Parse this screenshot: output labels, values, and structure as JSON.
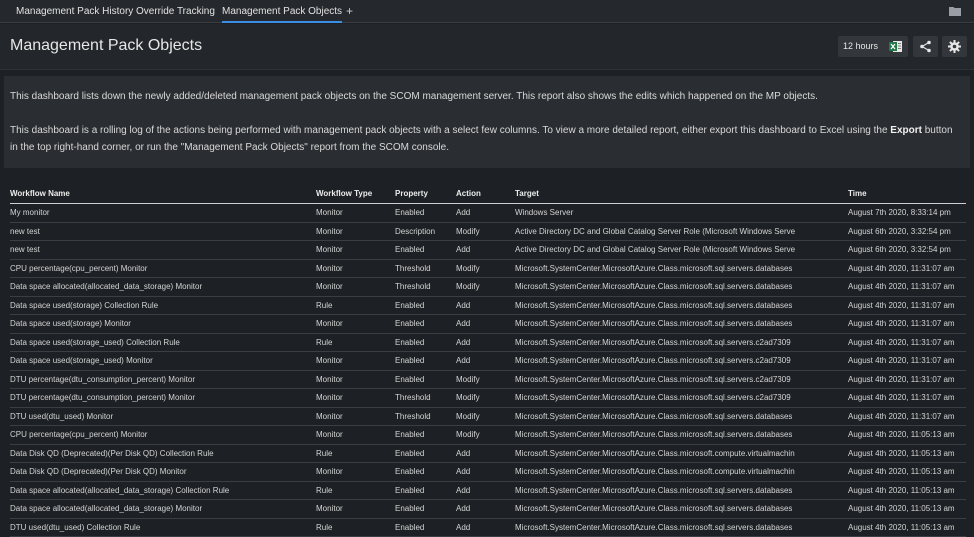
{
  "tabs": [
    {
      "label": "Management Pack History",
      "active": false
    },
    {
      "label": "Override Tracking",
      "active": false
    },
    {
      "label": "Management Pack Objects",
      "active": true
    }
  ],
  "add_tab_label": "+",
  "header": {
    "title": "Management Pack Objects",
    "time_range": "12 hours"
  },
  "description": {
    "p1": "This dashboard lists down the newly added/deleted management pack objects on the SCOM management server. This report also shows the edits which happened on the MP objects.",
    "p2_before": "This dashboard is a rolling log of the actions being performed with management pack objects with a select few columns. To view a more detailed report, either export this dashboard to Excel using the ",
    "p2_bold": "Export",
    "p2_after": " button in the top right-hand corner, or run the \"Management Pack Objects\" report from the SCOM console."
  },
  "columns": [
    "Workflow Name",
    "Workflow Type",
    "Property",
    "Action",
    "Target",
    "Time"
  ],
  "rows": [
    [
      "My monitor",
      "Monitor",
      "Enabled",
      "Add",
      "Windows Server",
      "August 7th 2020, 8:33:14 pm"
    ],
    [
      "new test",
      "Monitor",
      "Description",
      "Modify",
      "Active Directory DC and Global Catalog Server Role (Microsoft Windows Serve",
      "August 6th 2020, 3:32:54 pm"
    ],
    [
      "new test",
      "Monitor",
      "Enabled",
      "Add",
      "Active Directory DC and Global Catalog Server Role (Microsoft Windows Serve",
      "August 6th 2020, 3:32:54 pm"
    ],
    [
      "CPU percentage(cpu_percent) Monitor",
      "Monitor",
      "Threshold",
      "Modify",
      "Microsoft.SystemCenter.MicrosoftAzure.Class.microsoft.sql.servers.databases",
      "August 4th 2020, 11:31:07 am"
    ],
    [
      "Data space allocated(allocated_data_storage) Monitor",
      "Monitor",
      "Threshold",
      "Modify",
      "Microsoft.SystemCenter.MicrosoftAzure.Class.microsoft.sql.servers.databases",
      "August 4th 2020, 11:31:07 am"
    ],
    [
      "Data space used(storage) Collection Rule",
      "Rule",
      "Enabled",
      "Add",
      "Microsoft.SystemCenter.MicrosoftAzure.Class.microsoft.sql.servers.databases",
      "August 4th 2020, 11:31:07 am"
    ],
    [
      "Data space used(storage) Monitor",
      "Monitor",
      "Enabled",
      "Add",
      "Microsoft.SystemCenter.MicrosoftAzure.Class.microsoft.sql.servers.databases",
      "August 4th 2020, 11:31:07 am"
    ],
    [
      "Data space used(storage_used) Collection Rule",
      "Rule",
      "Enabled",
      "Add",
      "Microsoft.SystemCenter.MicrosoftAzure.Class.microsoft.sql.servers.c2ad7309",
      "August 4th 2020, 11:31:07 am"
    ],
    [
      "Data space used(storage_used) Monitor",
      "Monitor",
      "Enabled",
      "Add",
      "Microsoft.SystemCenter.MicrosoftAzure.Class.microsoft.sql.servers.c2ad7309",
      "August 4th 2020, 11:31:07 am"
    ],
    [
      "DTU percentage(dtu_consumption_percent) Monitor",
      "Monitor",
      "Enabled",
      "Modify",
      "Microsoft.SystemCenter.MicrosoftAzure.Class.microsoft.sql.servers.c2ad7309",
      "August 4th 2020, 11:31:07 am"
    ],
    [
      "DTU percentage(dtu_consumption_percent) Monitor",
      "Monitor",
      "Threshold",
      "Modify",
      "Microsoft.SystemCenter.MicrosoftAzure.Class.microsoft.sql.servers.c2ad7309",
      "August 4th 2020, 11:31:07 am"
    ],
    [
      "DTU used(dtu_used) Monitor",
      "Monitor",
      "Threshold",
      "Modify",
      "Microsoft.SystemCenter.MicrosoftAzure.Class.microsoft.sql.servers.databases",
      "August 4th 2020, 11:31:07 am"
    ],
    [
      "CPU percentage(cpu_percent) Monitor",
      "Monitor",
      "Enabled",
      "Modify",
      "Microsoft.SystemCenter.MicrosoftAzure.Class.microsoft.sql.servers.databases",
      "August 4th 2020, 11:05:13 am"
    ],
    [
      "Data Disk QD (Deprecated)(Per Disk QD) Collection Rule",
      "Rule",
      "Enabled",
      "Add",
      "Microsoft.SystemCenter.MicrosoftAzure.Class.microsoft.compute.virtualmachin",
      "August 4th 2020, 11:05:13 am"
    ],
    [
      "Data Disk QD (Deprecated)(Per Disk QD) Monitor",
      "Monitor",
      "Enabled",
      "Add",
      "Microsoft.SystemCenter.MicrosoftAzure.Class.microsoft.compute.virtualmachin",
      "August 4th 2020, 11:05:13 am"
    ],
    [
      "Data space allocated(allocated_data_storage) Collection Rule",
      "Rule",
      "Enabled",
      "Add",
      "Microsoft.SystemCenter.MicrosoftAzure.Class.microsoft.sql.servers.databases",
      "August 4th 2020, 11:05:13 am"
    ],
    [
      "Data space allocated(allocated_data_storage) Monitor",
      "Monitor",
      "Enabled",
      "Add",
      "Microsoft.SystemCenter.MicrosoftAzure.Class.microsoft.sql.servers.databases",
      "August 4th 2020, 11:05:13 am"
    ],
    [
      "DTU used(dtu_used) Collection Rule",
      "Rule",
      "Enabled",
      "Add",
      "Microsoft.SystemCenter.MicrosoftAzure.Class.microsoft.sql.servers.databases",
      "August 4th 2020, 11:05:13 am"
    ]
  ],
  "icons": {
    "folder": "folder-icon",
    "excel": "excel-icon",
    "share": "share-icon",
    "settings": "gear-icon"
  },
  "colors": {
    "background": "#1d2024",
    "panel": "#2a2d31",
    "accent": "#3a8ee6",
    "excel": "#1f7a45"
  }
}
